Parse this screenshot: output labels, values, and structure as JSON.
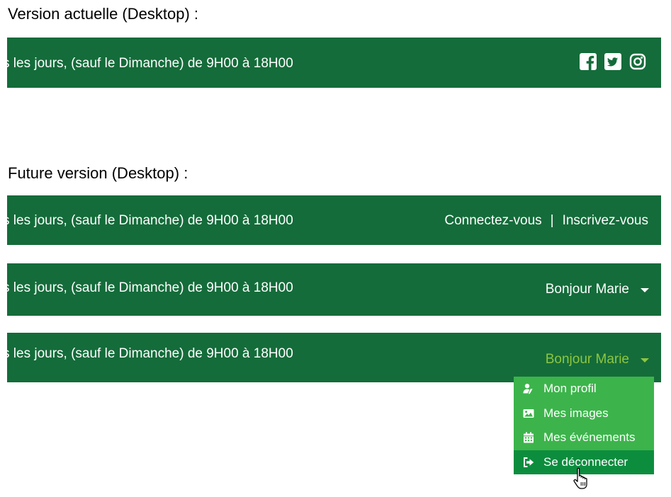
{
  "sections": {
    "current_heading": "Version actuelle (Desktop) :",
    "future_heading": "Future version (Desktop) :"
  },
  "topbar": {
    "hours_text": "s les jours, (sauf le Dimanche) de 9H00 à 18H00",
    "bg_color": "#146c3a"
  },
  "social": [
    "facebook-icon",
    "twitter-icon",
    "instagram-icon"
  ],
  "auth": {
    "login": "Connectez-vous",
    "separator": "|",
    "signup": "Inscrivez-vous"
  },
  "user": {
    "greeting": "Bonjour Marie",
    "active_color": "#8dc63f"
  },
  "dropdown": {
    "bg_color": "#3cb44b",
    "active_bg": "#0c8d3e",
    "items": [
      {
        "label": "Mon profil",
        "icon": "user-edit-icon"
      },
      {
        "label": "Mes images",
        "icon": "image-icon"
      },
      {
        "label": "Mes événements",
        "icon": "calendar-icon"
      },
      {
        "label": "Se déconnecter",
        "icon": "sign-out-icon",
        "active": true
      }
    ]
  }
}
